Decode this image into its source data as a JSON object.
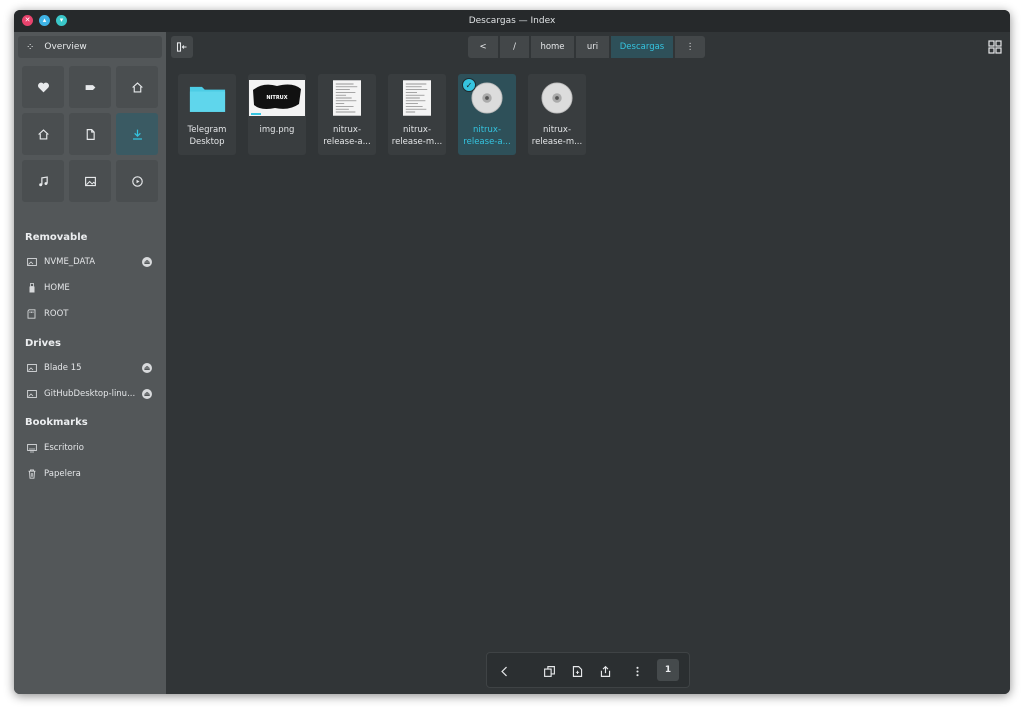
{
  "window": {
    "title": "Descargas — Index"
  },
  "sidebar": {
    "overview_label": "Overview",
    "quick_access": [
      {
        "icon": "heart-icon"
      },
      {
        "icon": "tag-icon"
      },
      {
        "icon": "home-icon"
      },
      {
        "icon": "home-icon"
      },
      {
        "icon": "document-icon"
      },
      {
        "icon": "download-icon",
        "active": true
      },
      {
        "icon": "music-icon"
      },
      {
        "icon": "image-icon"
      },
      {
        "icon": "video-icon"
      }
    ],
    "sections": {
      "removable": "Removable",
      "drives": "Drives",
      "bookmarks": "Bookmarks"
    },
    "removable_items": [
      {
        "label": "NVME_DATA",
        "icon": "drive-icon",
        "eject": true
      },
      {
        "label": "HOME",
        "icon": "usb-icon",
        "eject": false
      },
      {
        "label": "ROOT",
        "icon": "sd-card-icon",
        "eject": false
      }
    ],
    "drive_items": [
      {
        "label": "Blade 15",
        "icon": "drive-icon",
        "eject": true
      },
      {
        "label": "GitHubDesktop-linu...",
        "icon": "drive-icon",
        "eject": true
      }
    ],
    "bookmark_items": [
      {
        "label": "Escritorio",
        "icon": "desktop-icon"
      },
      {
        "label": "Papelera",
        "icon": "trash-icon"
      }
    ]
  },
  "pathbar": {
    "back": "<",
    "crumbs": [
      "/",
      "home",
      "uri",
      "Descargas"
    ],
    "more": "⋮"
  },
  "files": [
    {
      "name": "Telegram Desktop",
      "line1": "Telegram",
      "line2": "Desktop",
      "type": "folder"
    },
    {
      "name": "img.png",
      "line1": "img.png",
      "line2": "",
      "type": "image",
      "thumb_text": "NITRUX"
    },
    {
      "name": "nitrux-release-a...",
      "line1": "nitrux-",
      "line2": "release-a...",
      "type": "text"
    },
    {
      "name": "nitrux-release-m...",
      "line1": "nitrux-",
      "line2": "release-m...",
      "type": "text"
    },
    {
      "name": "nitrux-release-a...",
      "line1": "nitrux-",
      "line2": "release-a...",
      "type": "disc",
      "selected": true
    },
    {
      "name": "nitrux-release-m...",
      "line1": "nitrux-",
      "line2": "release-m...",
      "type": "disc"
    }
  ],
  "selection_bar": {
    "count": "1",
    "actions": [
      "back",
      "copy",
      "paste",
      "share",
      "more"
    ]
  },
  "colors": {
    "accent": "#35c4e0",
    "sidebar": "#535759",
    "content": "#313537",
    "titlebar": "#26292b",
    "selected": "#2e5059"
  }
}
